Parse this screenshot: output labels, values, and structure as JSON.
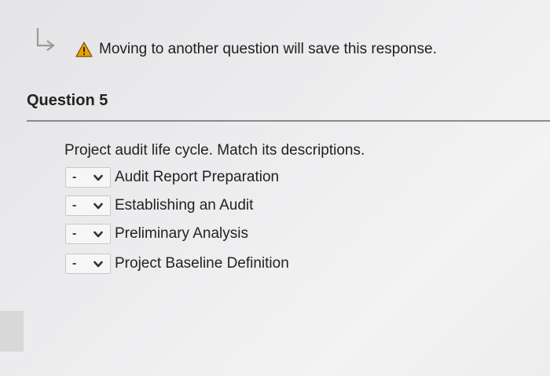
{
  "notice": {
    "text": "Moving to another question will save this response.",
    "icon": "warning-icon",
    "icon_color": "#e8a200"
  },
  "question": {
    "title": "Question 5",
    "prompt": "Project audit life cycle. Match its descriptions.",
    "items": [
      {
        "selected": "-",
        "label": "Audit Report Preparation"
      },
      {
        "selected": "-",
        "label": "Establishing an Audit"
      },
      {
        "selected": "-",
        "label": "Preliminary Analysis"
      },
      {
        "selected": "-",
        "label": "Project Baseline Definition"
      }
    ]
  }
}
